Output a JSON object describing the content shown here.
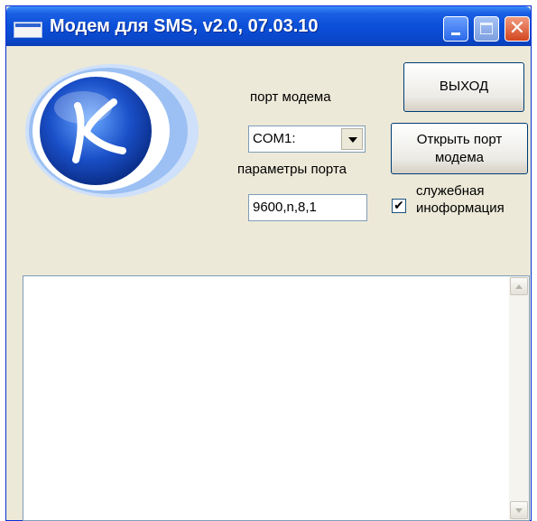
{
  "window": {
    "title": "Модем для SMS, v2.0, 07.03.10",
    "close_glyph": "✕"
  },
  "logo": {
    "letter": "K",
    "icon": "k-logo-icon"
  },
  "port": {
    "label": "порт модема",
    "selected": "COM1:",
    "params_label": "параметры порта",
    "params_value": "9600,n,8,1"
  },
  "buttons": {
    "exit": "ВЫХОД",
    "open_line1": "Открыть порт",
    "open_line2": "модема"
  },
  "service_info": {
    "checked": true,
    "check_mark": "✔",
    "label_line1": "служебная",
    "label_line2": "иноформация"
  },
  "log": {
    "content": ""
  },
  "colors": {
    "titlebar": "#0b4fd8",
    "window_bg": "#ece9d8",
    "logo_blue": "#1846b8"
  }
}
